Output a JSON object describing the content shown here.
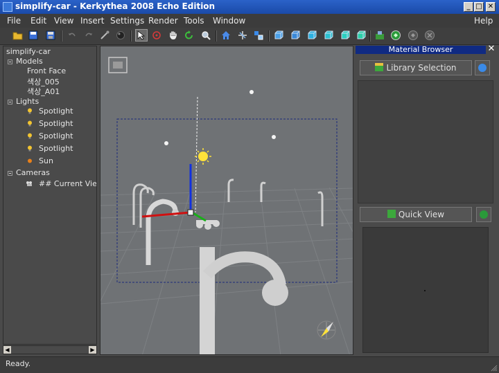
{
  "window": {
    "title": "simplify-car - Kerkythea 2008 Echo Edition",
    "minimize_label": "_",
    "maximize_label": "□",
    "close_label": "✕"
  },
  "menu": {
    "file": "File",
    "edit": "Edit",
    "view": "View",
    "insert": "Insert",
    "settings": "Settings",
    "render": "Render",
    "tools": "Tools",
    "window": "Window",
    "help": "Help"
  },
  "toolbar": {
    "icons": [
      "open-icon",
      "save-icon",
      "save-as-icon",
      "undo-icon",
      "redo-icon",
      "brush-icon",
      "sphere-icon",
      "select-icon",
      "target-icon",
      "pan-hand-icon",
      "rotate-icon",
      "zoom-icon",
      "home-icon",
      "move-icon",
      "scale-icon",
      "front-view-icon",
      "back-view-icon",
      "left-view-icon",
      "right-view-icon",
      "top-view-icon",
      "bottom-view-icon",
      "render-settings-icon",
      "render-icon",
      "render-alt-icon",
      "stop-render-icon"
    ]
  },
  "scene_tree": {
    "root": "simplify-car",
    "models_label": "Models",
    "models": [
      "Front Face",
      "색상_005",
      "색상_A01"
    ],
    "lights_label": "Lights",
    "lights": [
      "Spotlight",
      "Spotlight",
      "Spotlight",
      "Spotlight",
      "Sun"
    ],
    "cameras_label": "Cameras",
    "cameras": [
      "## Current View"
    ]
  },
  "material_browser": {
    "title": "Material Browser",
    "close_label": "✕",
    "library_button": "Library Selection",
    "quick_view_button": "Quick View"
  },
  "status": {
    "text": "Ready."
  },
  "colors": {
    "titlebar": "#1a4aa8",
    "panel_title": "#102a82",
    "viewport_bg": "#6f7275",
    "axis_x": "#d01010",
    "axis_y": "#18b018",
    "axis_z": "#1030e0",
    "sun": "#ffe23a"
  }
}
